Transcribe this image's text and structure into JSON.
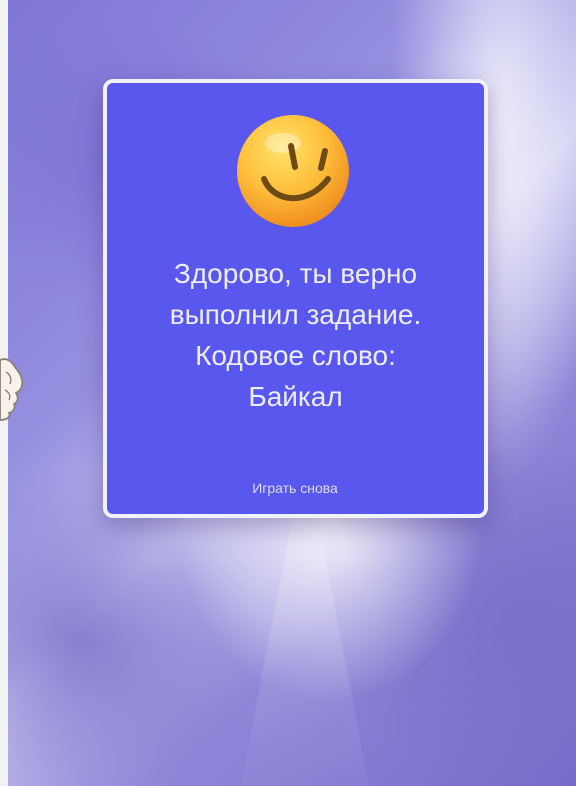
{
  "colors": {
    "card_background": "#5a57ee",
    "card_border": "#f1f1f9",
    "text_primary": "#eceeff",
    "text_secondary": "#d9dcff"
  },
  "dialog": {
    "icon": "smiley-face-icon",
    "message_lines": [
      "Здорово, ты верно",
      "выполнил задание.",
      "Кодовое слово:",
      "Байкал"
    ],
    "play_again_label": "Играть снова"
  },
  "decorations": {
    "left_hand": "hand-icon"
  }
}
